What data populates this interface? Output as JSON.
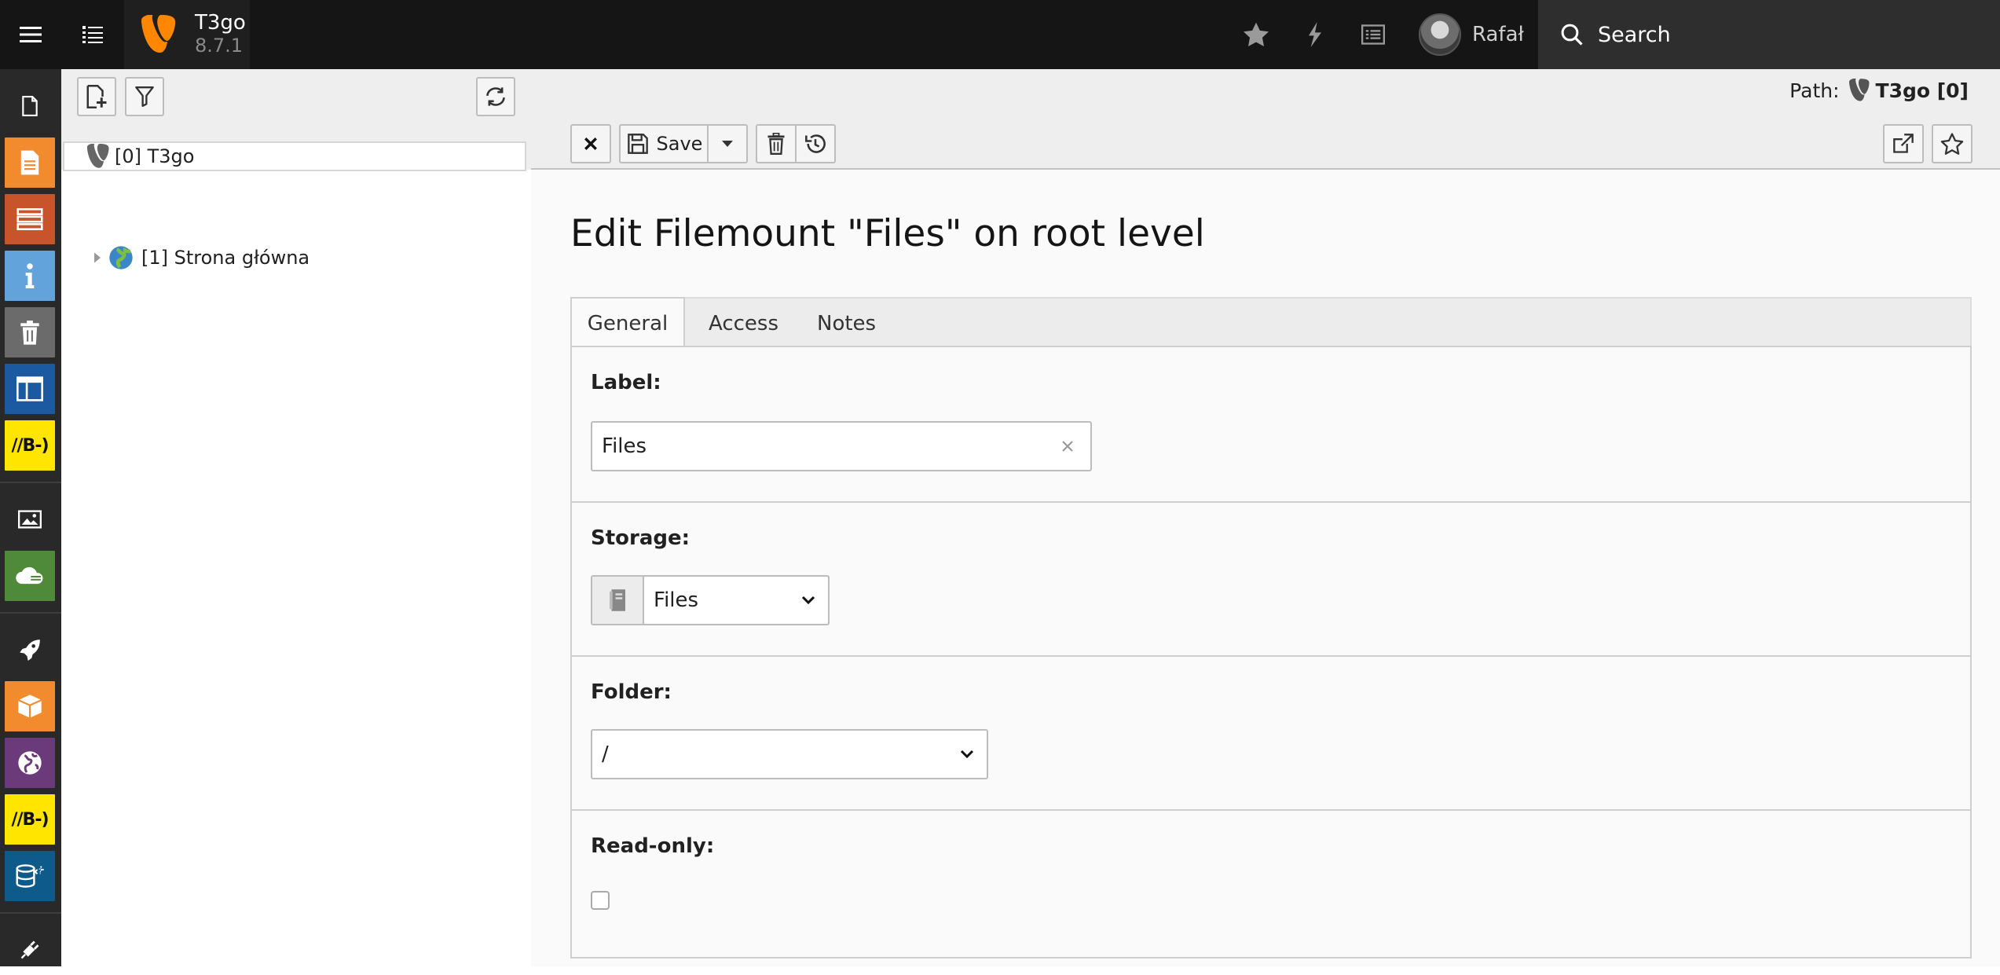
{
  "topbar": {
    "site_name": "T3go",
    "version": "8.7.1",
    "user_name": "Rafał",
    "search_label": "Search"
  },
  "modules": [
    {
      "name": "page",
      "icon": "page-icon",
      "color": ""
    },
    {
      "name": "web-page",
      "icon": "document-icon",
      "color": "#f28b2d"
    },
    {
      "name": "list",
      "icon": "list-icon",
      "color": "#c8542b"
    },
    {
      "name": "info",
      "icon": "info-icon",
      "color": "#62a3dc"
    },
    {
      "name": "recycler",
      "icon": "trash-icon",
      "color": "#6b6b6b"
    },
    {
      "name": "template",
      "icon": "layout-icon",
      "color": "#1b5aa0"
    },
    {
      "name": "brainy-1",
      "icon": "bb-icon",
      "label": "//B-)",
      "color": "#ffe500"
    },
    {
      "name": "filelist",
      "icon": "image-icon",
      "color": ""
    },
    {
      "name": "cloud",
      "icon": "cloud-icon",
      "color": "#4f8a3a"
    },
    {
      "name": "rocket",
      "icon": "rocket-icon",
      "color": ""
    },
    {
      "name": "extensions",
      "icon": "box-icon",
      "color": "#f28b2d"
    },
    {
      "name": "sites",
      "icon": "globe-icon",
      "color": "#6b3a7a"
    },
    {
      "name": "brainy-2",
      "icon": "bb-icon",
      "label": "//B-)",
      "color": "#ffe500"
    },
    {
      "name": "db",
      "icon": "database-icon",
      "color": "#0e5a8a"
    },
    {
      "name": "plugin",
      "icon": "plug-icon",
      "color": ""
    }
  ],
  "tree": {
    "root": "[0] T3go",
    "child": "[1] Strona główna"
  },
  "docheader": {
    "path_label": "Path:",
    "path_title": "T3go [0]",
    "save_label": "Save"
  },
  "form": {
    "title": "Edit Filemount \"Files\" on root level",
    "tabs": [
      "General",
      "Access",
      "Notes"
    ],
    "label_label": "Label:",
    "label_value": "Files",
    "storage_label": "Storage:",
    "storage_value": "Files",
    "folder_label": "Folder:",
    "folder_value": "/",
    "readonly_label": "Read-only:"
  }
}
